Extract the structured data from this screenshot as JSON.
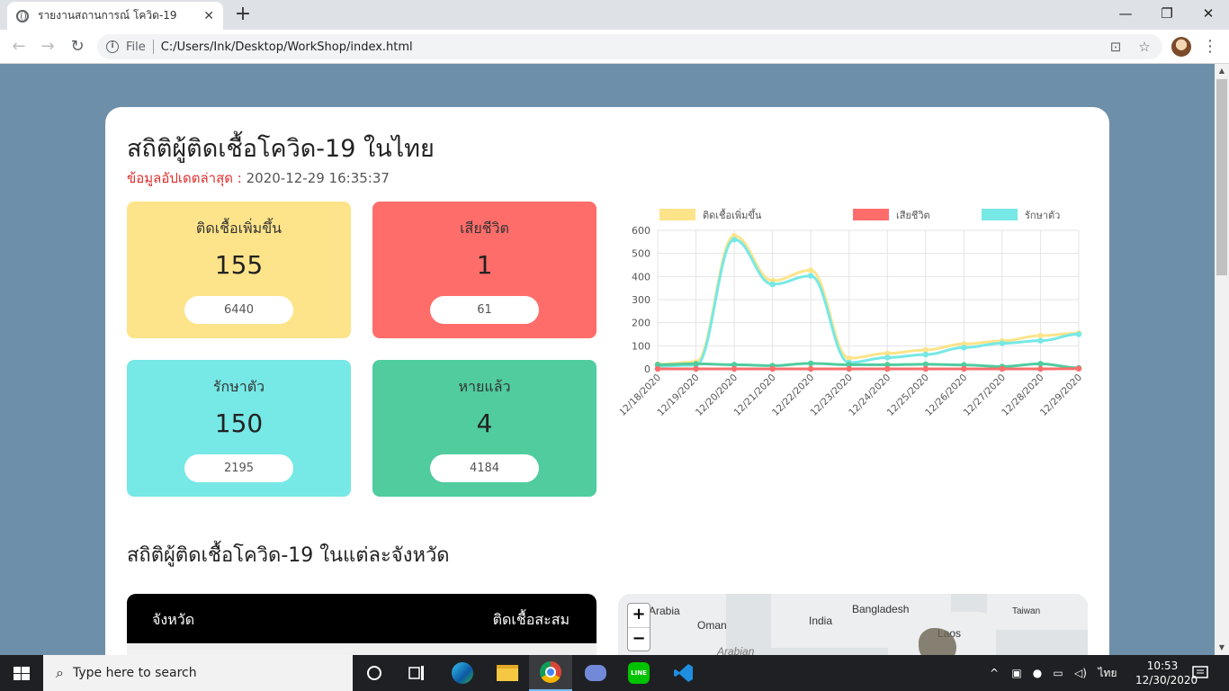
{
  "browser": {
    "tab_title": "รายงานสถานการณ์ โควิด-19",
    "tab_close": "✕",
    "new_tab": "+",
    "url_scheme_label": "File",
    "url": "C:/Users/Ink/Desktop/WorkShop/index.html",
    "window_controls": {
      "minimize": "—",
      "maximize": "❐",
      "close": "✕"
    }
  },
  "page": {
    "title": "สถิติผู้ติดเชื้อโควิด-19 ในไทย",
    "update_label": "ข้อมูลอัปเดตล่าสุด :",
    "update_value": "2020-12-29 16:35:37",
    "stats": [
      {
        "label": "ติดเชื้อเพิ่มขึ้น",
        "value": "155",
        "total": "6440",
        "color": "#fde48a"
      },
      {
        "label": "เสียชีวิต",
        "value": "1",
        "total": "61",
        "color": "#ff6d6a"
      },
      {
        "label": "รักษาตัว",
        "value": "150",
        "total": "2195",
        "color": "#76e8e6"
      },
      {
        "label": "หายแล้ว",
        "value": "4",
        "total": "4184",
        "color": "#50cc9e"
      }
    ],
    "section_title": "สถิติผู้ติดเชื้อโควิด-19 ในแต่ละจังหวัด",
    "table": {
      "col_province": "จังหวัด",
      "col_cumulative": "ติดเชื้อสะสม"
    },
    "map": {
      "labels": [
        "Arabia",
        "Oman",
        "India",
        "Bangladesh",
        "Taiwan",
        "Laos",
        "Arabian"
      ],
      "zoom_in": "+",
      "zoom_out": "−"
    }
  },
  "chart_data": {
    "type": "line",
    "categories": [
      "12/18/2020",
      "12/19/2020",
      "12/20/2020",
      "12/21/2020",
      "12/22/2020",
      "12/23/2020",
      "12/24/2020",
      "12/25/2020",
      "12/26/2020",
      "12/27/2020",
      "12/28/2020",
      "12/29/2020"
    ],
    "series": [
      {
        "name": "ติดเชื้อเพิ่มขึ้น",
        "color": "#fde48a",
        "values": [
          20,
          30,
          576,
          382,
          427,
          46,
          67,
          82,
          108,
          121,
          144,
          155
        ]
      },
      {
        "name": "เสียชีวิต",
        "color": "#ff6d6a",
        "values": [
          0,
          0,
          0,
          0,
          0,
          0,
          0,
          0,
          0,
          0,
          0,
          1
        ]
      },
      {
        "name": "รักษาตัว",
        "color": "#76e8e6",
        "values": [
          12,
          16,
          560,
          366,
          403,
          27,
          49,
          62,
          92,
          111,
          122,
          150
        ]
      },
      {
        "name": "หายแล้ว",
        "color": "#50cc9e",
        "values": [
          18,
          22,
          18,
          14,
          24,
          18,
          18,
          20,
          17,
          10,
          22,
          4
        ]
      }
    ],
    "ylim": [
      0,
      600
    ],
    "yticks": [
      0,
      100,
      200,
      300,
      400,
      500,
      600
    ],
    "grid": true,
    "legend": "top"
  },
  "taskbar": {
    "search_placeholder": "Type here to search",
    "lang": "ไทย",
    "time": "10:53",
    "date": "12/30/2020"
  }
}
